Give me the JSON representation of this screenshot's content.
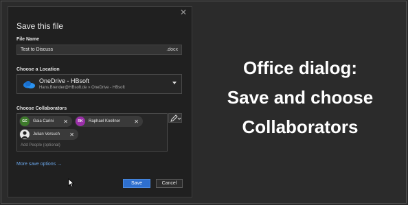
{
  "dialog": {
    "title": "Save this file",
    "close_symbol": "✕",
    "file_name": {
      "label": "File Name",
      "value": "Test to Discuss",
      "extension": ".docx"
    },
    "location": {
      "label": "Choose a Location",
      "name": "OneDrive - HBsoft",
      "path": "Hans.Brender@HBsoft.de » OneDrive - HBsoft",
      "icon": "onedrive-cloud-icon",
      "icon_color": "#1f7ee0"
    },
    "collaborators": {
      "label": "Choose Collaborators",
      "people": [
        {
          "initials": "GC",
          "name": "Gaia Carini",
          "color": "#3d7a2a"
        },
        {
          "initials": "RK",
          "name": "Raphael Koellner",
          "color": "#9a2fa8"
        },
        {
          "initials": "",
          "name": "Julian Versuch",
          "color": "#111111"
        }
      ],
      "remove_symbol": "✕",
      "placeholder": "Add People (optional)"
    },
    "more_options": "More save options →",
    "save_label": "Save",
    "cancel_label": "Cancel"
  },
  "overlay": {
    "line1": "Office dialog:",
    "line2": "Save and choose",
    "line3": "Collaborators"
  },
  "colors": {
    "accent": "#2e6fce",
    "link": "#6aa6ea",
    "background": "#2b2b2b",
    "dialog": "#202020"
  }
}
